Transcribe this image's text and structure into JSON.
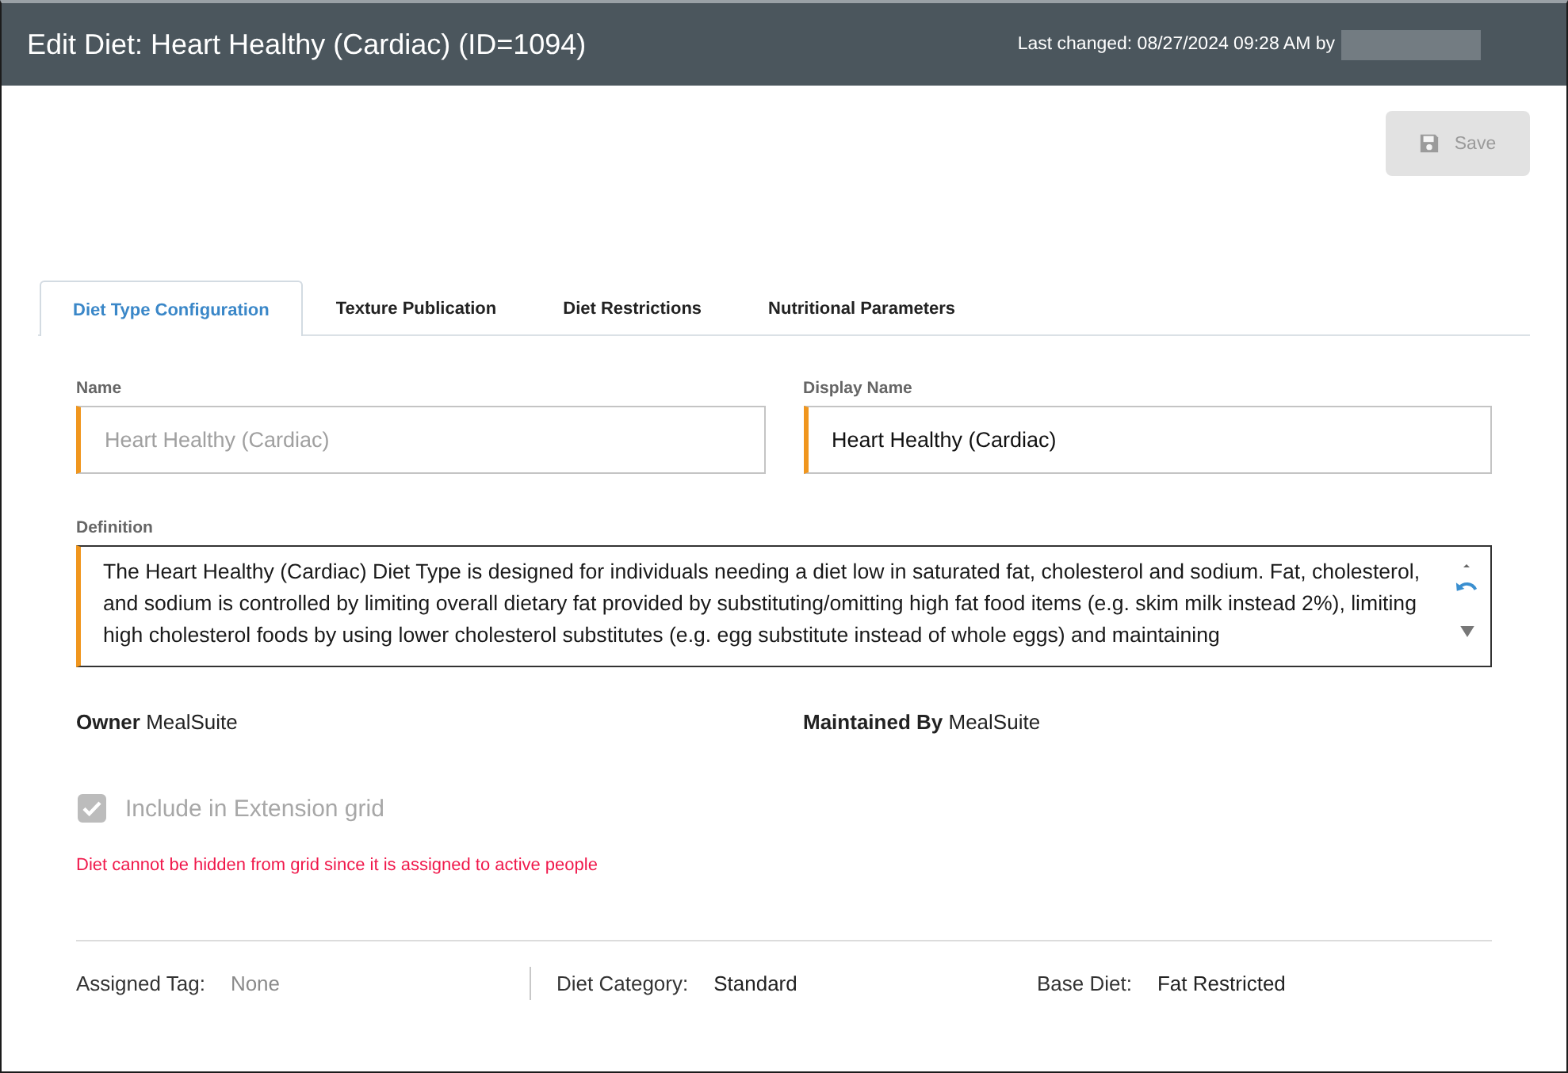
{
  "header": {
    "title": "Edit Diet: Heart Healthy (Cardiac) (ID=1094)",
    "last_changed": "Last changed: 08/27/2024 09:28 AM by"
  },
  "save_button": {
    "label": "Save",
    "disabled": true
  },
  "tabs": [
    {
      "label": "Diet Type Configuration",
      "selected": true
    },
    {
      "label": "Texture Publication",
      "selected": false
    },
    {
      "label": "Diet Restrictions",
      "selected": false
    },
    {
      "label": "Nutritional Parameters",
      "selected": false
    }
  ],
  "fields": [
    {
      "label": "Name",
      "value": "Heart Healthy (Cardiac)",
      "disabled": true
    },
    {
      "label": "Display Name",
      "value": "Heart Healthy (Cardiac)",
      "disabled": false
    }
  ],
  "definition": {
    "label": "Definition",
    "value": "The Heart Healthy (Cardiac) Diet Type is designed for individuals needing a diet low in saturated fat, cholesterol and sodium. Fat, cholesterol, and sodium is controlled by limiting overall dietary fat provided by substituting/omitting high fat food items (e.g. skim milk instead 2%), limiting high cholesterol foods by using lower cholesterol substitutes (e.g. egg substitute instead of whole eggs) and maintaining"
  },
  "ownership": [
    {
      "label": "Owner",
      "value": "MealSuite"
    },
    {
      "label": "Maintained By",
      "value": "MealSuite"
    }
  ],
  "include_checkbox": {
    "label": "Include in Extension grid",
    "checked": true,
    "disabled": true
  },
  "error_message": "Diet cannot be hidden from grid since it is assigned to active people",
  "summary": [
    {
      "label": "Assigned Tag:",
      "value": "None",
      "empty": true
    },
    {
      "label": "Diet Category:",
      "value": "Standard",
      "empty": false
    },
    {
      "label": "Base Diet:",
      "value": "Fat Restricted",
      "empty": false
    }
  ]
}
